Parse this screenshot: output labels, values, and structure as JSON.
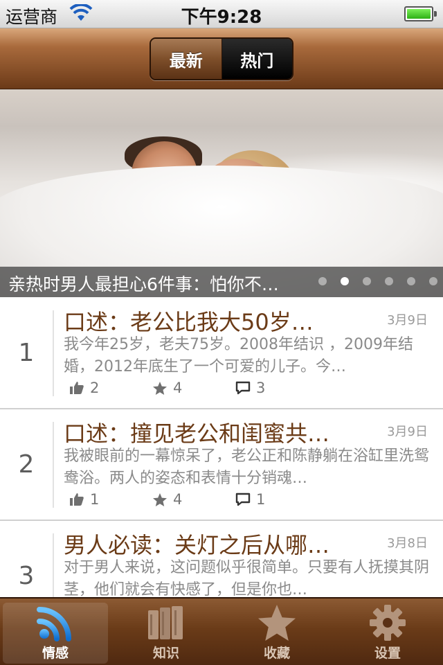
{
  "status_bar": {
    "carrier": "运营商",
    "time": "下午9:28"
  },
  "nav": {
    "segments": [
      {
        "label": "最新",
        "selected": false
      },
      {
        "label": "热门",
        "selected": true
      }
    ]
  },
  "banner": {
    "caption": "亲热时男人最担心6件事：怕你不…",
    "page_count": 6,
    "active_page": 2
  },
  "articles": [
    {
      "rank": "1",
      "title": "口述：老公比我大50岁…",
      "date": "3月9日",
      "summary": "我今年25岁，老夫75岁。2008年结识 ，2009年结婚，2012年底生了一个可爱的儿子。今…",
      "likes": "2",
      "favorites": "4",
      "comments": "3"
    },
    {
      "rank": "2",
      "title": "口述：撞见老公和闺蜜共…",
      "date": "3月9日",
      "summary": "我被眼前的一幕惊呆了，老公正和陈静躺在浴缸里洗鸳鸯浴。两人的姿态和表情十分销魂…",
      "likes": "1",
      "favorites": "4",
      "comments": "1"
    },
    {
      "rank": "3",
      "title": "男人必读：关灯之后从哪…",
      "date": "3月8日",
      "summary": "对于男人来说，这问题似乎很简单。只要有人抚摸其阴茎，他们就会有快感了，但是你也…",
      "likes": "",
      "favorites": "",
      "comments": ""
    }
  ],
  "tabs": [
    {
      "label": "情感",
      "icon": "rss-icon",
      "selected": true
    },
    {
      "label": "知识",
      "icon": "books-icon",
      "selected": false
    },
    {
      "label": "收藏",
      "icon": "star-icon",
      "selected": false
    },
    {
      "label": "设置",
      "icon": "gear-icon",
      "selected": false
    }
  ],
  "colors": {
    "nav_brown": "#6b3a18",
    "title_brown": "#6b3b17",
    "rss_blue": "#1f8fe6",
    "battery_green": "#2eb016"
  }
}
